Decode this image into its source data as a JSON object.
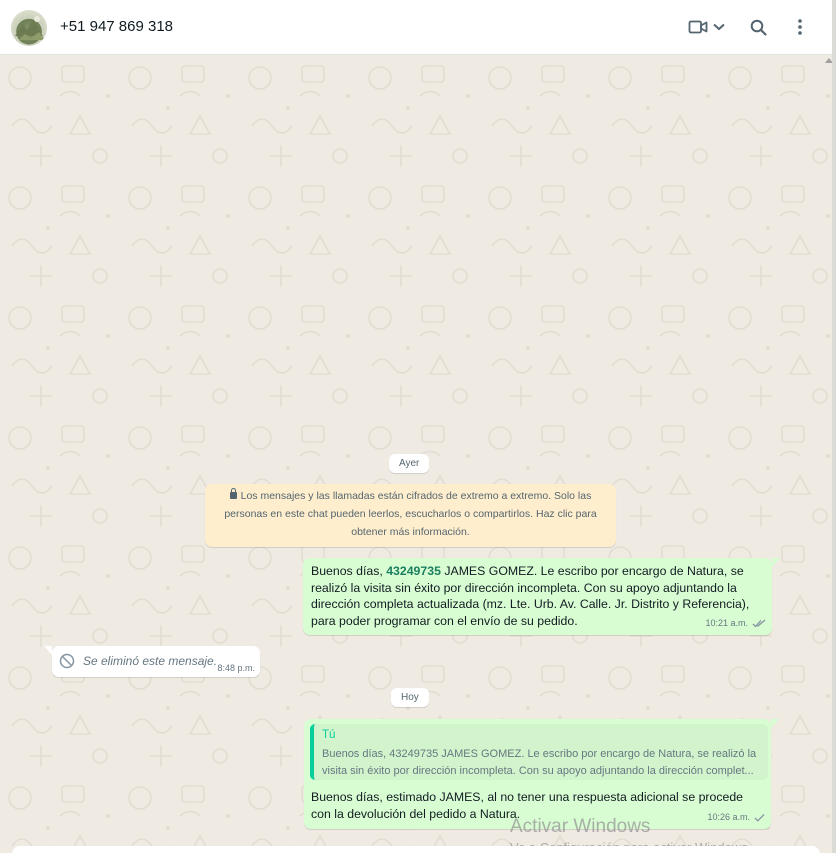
{
  "header": {
    "contact_name": "+51 947 869 318",
    "icons": [
      "video-call-icon",
      "chevron-down-icon",
      "search-icon",
      "menu-icon"
    ]
  },
  "chat": {
    "day_yesterday": "Ayer",
    "day_today": "Hoy",
    "encryption_notice": "Los mensajes y las llamadas están cifrados de extremo a extremo. Solo las personas en este chat pueden leerlos, escucharlos o compartirlos. Haz clic para obtener más información.",
    "message1": {
      "prefix": "Buenos días, ",
      "highlight": "43249735",
      "text": " JAMES GOMEZ. Le escribo por encargo de Natura, se realizó la visita sin éxito por dirección incompleta. Con su apoyo adjuntando la dirección completa actualizada (mz. Lte. Urb. Av. Calle. Jr. Distrito y Referencia), para poder programar con el envío de su pedido.",
      "time": "10:21 a.m.",
      "status": "read"
    },
    "deleted_message": {
      "text": "Se eliminó este mensaje.",
      "time": "8:48 p.m."
    },
    "message2": {
      "quote_author": "Tú",
      "quote_text": "Buenos días, 43249735 JAMES GOMEZ. Le escribo por encargo de Natura, se realizó la visita sin éxito por dirección incompleta. Con su apoyo adjuntando la dirección complet...",
      "text": "Buenos días, estimado JAMES, al no tener una respuesta adicional se procede con la devolución del pedido a Natura.",
      "time": "10:26 a.m.",
      "status": "sent"
    }
  },
  "watermark": {
    "line1": "Activar Windows",
    "line2": "Ve a Configuración para activar Windows."
  },
  "colors": {
    "outgoing_bubble": "#d9fdd3",
    "incoming_bubble": "#ffffff",
    "chat_background": "#efeae2",
    "accent": "#06cf9c",
    "read_ticks": "#667781"
  }
}
